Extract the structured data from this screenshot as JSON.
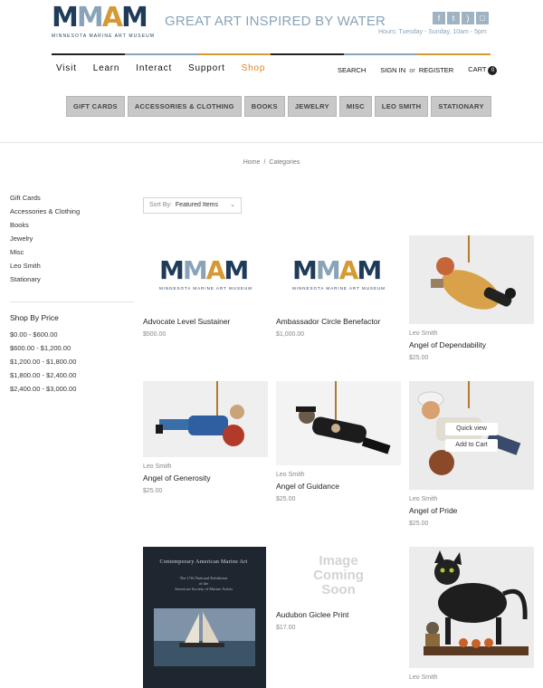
{
  "header": {
    "logo": {
      "letters": [
        "M",
        "M",
        "A",
        "M"
      ],
      "subtitle": "MINNESOTA MARINE ART MUSEUM"
    },
    "tagline": "GREAT ART INSPIRED BY WATER",
    "social_icons": [
      "facebook-icon",
      "twitter-icon",
      "rss-icon",
      "contact-icon"
    ],
    "hours": "Hours: Tuesday - Sunday, 10am - 5pm"
  },
  "colors": {
    "navy": "#1f3b5a",
    "gold": "#d59a33",
    "steel": "#8aa3b8",
    "shop_orange": "#e0822b"
  },
  "main_nav": [
    "Visit",
    "Learn",
    "Interact",
    "Support",
    "Shop"
  ],
  "util_nav": {
    "search": "SEARCH",
    "signin": "SIGN IN",
    "or": "or",
    "register": "REGISTER",
    "cart": "CART",
    "cart_count": "0"
  },
  "category_nav": [
    "GIFT CARDS",
    "ACCESSORIES & CLOTHING",
    "BOOKS",
    "JEWELRY",
    "MISC",
    "LEO SMITH",
    "STATIONARY"
  ],
  "breadcrumb": {
    "home": "Home",
    "separator": "/",
    "current": "Categories"
  },
  "sidebar": {
    "categories": [
      "Gift Cards",
      "Accessories & Clothing",
      "Books",
      "Jewelry",
      "Misc",
      "Leo Smith",
      "Stationary"
    ],
    "price_title": "Shop By Price",
    "prices": [
      "$0.00 - $600.00",
      "$600.00 - $1,200.00",
      "$1,200.00 - $1,800.00",
      "$1,800.00 - $2,400.00",
      "$2,400.00 - $3,000.00"
    ]
  },
  "sort": {
    "label": "Sort By:",
    "value": "Featured Items"
  },
  "products": [
    {
      "brand": "",
      "name": "Advocate Level Sustainer",
      "price": "$500.00"
    },
    {
      "brand": "",
      "name": "Ambassador Circle Benefactor",
      "price": "$1,000.00"
    },
    {
      "brand": "Leo Smith",
      "name": "Angel of Dependability",
      "price": "$25.00"
    },
    {
      "brand": "Leo Smith",
      "name": "Angel of Generosity",
      "price": "$25.00"
    },
    {
      "brand": "Leo Smith",
      "name": "Angel of Guidance",
      "price": "$25.00"
    },
    {
      "brand": "Leo Smith",
      "name": "Angel of Pride",
      "price": "$25.00"
    },
    {
      "brand": "",
      "name": "",
      "price": ""
    },
    {
      "brand": "",
      "name": "Audubon Giclee Print",
      "price": "$17.00"
    },
    {
      "brand": "Leo Smith",
      "name": "",
      "price": ""
    }
  ],
  "product_overlay": {
    "quick_view": "Quick view",
    "add_to_cart": "Add to Cart"
  },
  "placeholder_image": {
    "line1": "Image",
    "line2": "Coming",
    "line3": "Soon"
  },
  "book_cover": {
    "title": "Contemporary American Marine Art",
    "line1": "The 17th National Exhibition",
    "line2": "of the",
    "line3": "American Society of Marine Artists"
  }
}
